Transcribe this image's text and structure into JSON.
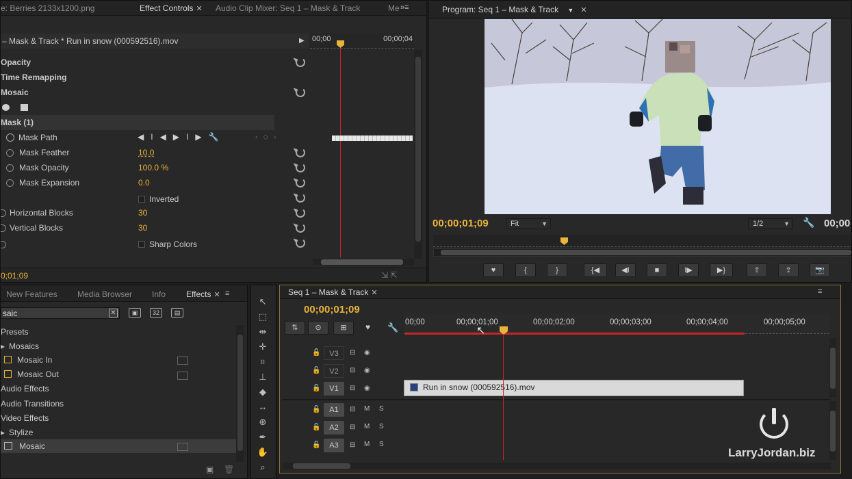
{
  "effect_controls": {
    "tabs": [
      "e: Berries 2133x1200.png",
      "Effect Controls",
      "Audio Clip Mixer: Seq 1 – Mask & Track",
      "Me"
    ],
    "clip_header": "– Mask & Track * Run in snow (000592516).mov",
    "ruler": {
      "start": "00;00",
      "end": "00;00;04"
    },
    "rows": {
      "opacity": "Opacity",
      "time_remapping": "Time Remapping",
      "mosaic": "Mosaic",
      "mask_1": "Mask (1)",
      "mask_path": "Mask Path",
      "mask_feather": "Mask Feather",
      "mask_feather_value": "10.0",
      "mask_opacity": "Mask Opacity",
      "mask_opacity_value": "100.0 %",
      "mask_expansion": "Mask Expansion",
      "mask_expansion_value": "0.0",
      "inverted": "Inverted",
      "horizontal_blocks": "Horizontal Blocks",
      "horizontal_blocks_value": "30",
      "vertical_blocks": "Vertical Blocks",
      "vertical_blocks_value": "30",
      "sharp_colors": "Sharp Colors"
    },
    "timecode": "0;01;09"
  },
  "program": {
    "tab": "Program: Seq 1 – Mask & Track",
    "timecode": "00;00;01;09",
    "fit": "Fit",
    "resolution": "1/2",
    "duration": "00;00"
  },
  "effects": {
    "tabs": [
      "New Features",
      "Media Browser",
      "Info",
      "Effects"
    ],
    "search": "saic",
    "tree": {
      "presets": "Presets",
      "mosaics": "Mosaics",
      "mosaic_in": "Mosaic In",
      "mosaic_out": "Mosaic Out",
      "audio_effects": "Audio Effects",
      "audio_transitions": "Audio Transitions",
      "video_effects": "Video Effects",
      "stylize": "Stylize",
      "mosaic": "Mosaic"
    }
  },
  "timeline": {
    "tab": "Seq 1 – Mask & Track",
    "timecode": "00;00;01;09",
    "ruler": [
      "00;00",
      "00;00;01;00",
      "00;00;02;00",
      "00;00;03;00",
      "00;00;04;00",
      "00;00;05;00"
    ],
    "video_tracks": [
      "V3",
      "V2",
      "V1"
    ],
    "audio_tracks": [
      "A1",
      "A2",
      "A3"
    ],
    "mute": "M",
    "solo": "S",
    "clip_name": "Run in snow (000592516).mov"
  },
  "watermark": "LarryJordan.biz",
  "colors": {
    "accent": "#e8b43a",
    "playhead": "#c8262a",
    "panel": "#282828",
    "panel_dark": "#1d1d1d",
    "snow": "#dfe4f4"
  }
}
